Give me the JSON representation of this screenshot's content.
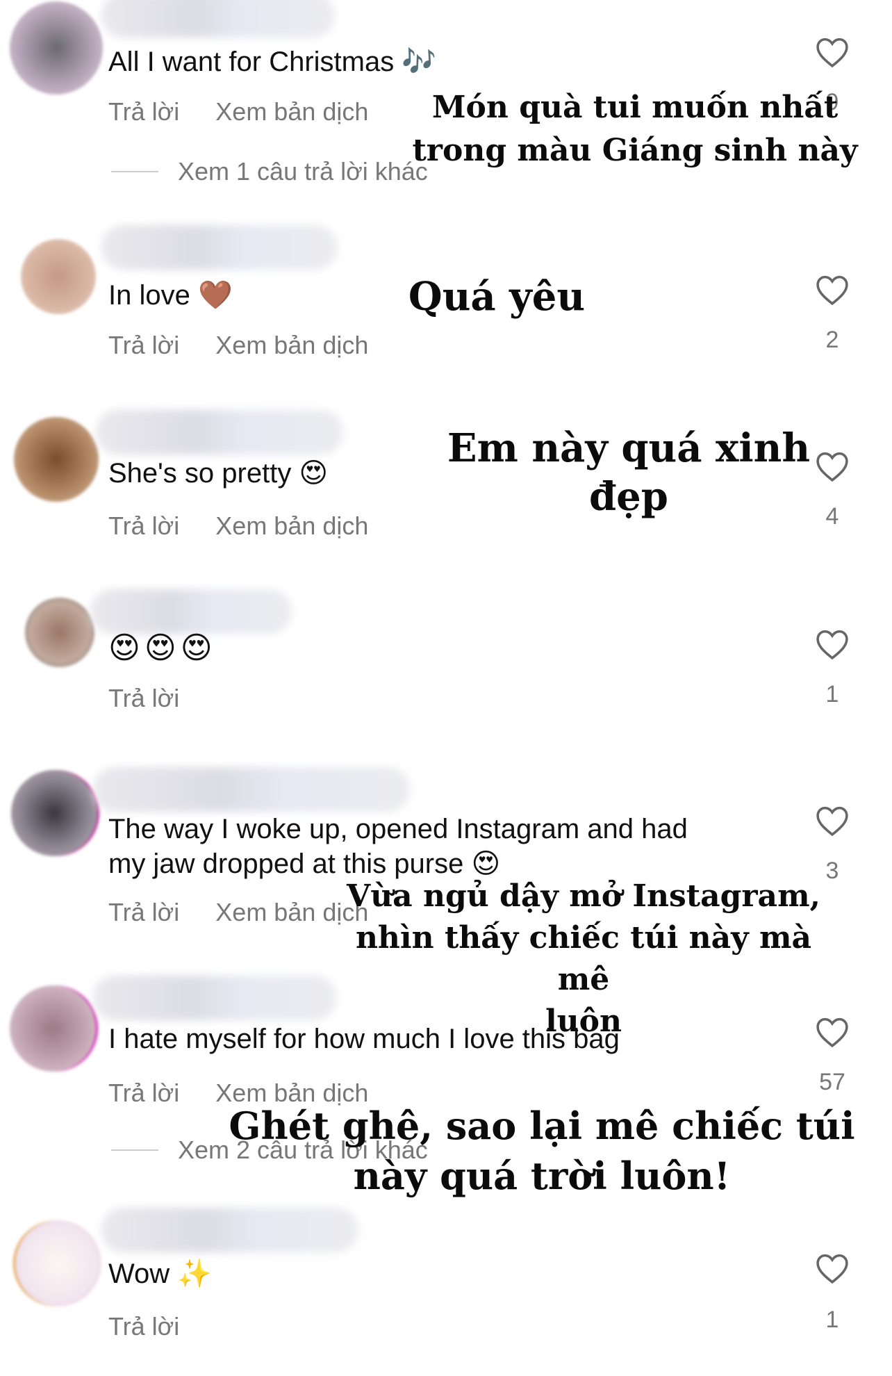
{
  "labels": {
    "reply": "Trả lời",
    "translate": "Xem bản dịch"
  },
  "comments": [
    {
      "text": "All I want for Christmas 🎶",
      "likes": "9",
      "has_translate": true,
      "more_replies": "Xem 1 câu trả lời khác",
      "overlay": "Món quà tui muốn nhất\ntrong màu Giáng sinh này"
    },
    {
      "text": "In love 🤎",
      "likes": "2",
      "has_translate": true,
      "overlay": "Quá yêu"
    },
    {
      "text": "She's so pretty 😍",
      "likes": "4",
      "has_translate": true,
      "overlay": "Em này quá xinh đẹp"
    },
    {
      "text": "😍😍😍",
      "likes": "1",
      "has_translate": false
    },
    {
      "text": "The way I woke up, opened Instagram and had\nmy jaw dropped at this purse 😍",
      "likes": "3",
      "has_translate": true,
      "overlay": "Vừa ngủ dậy mở Instagram,\nnhìn thấy chiếc túi này mà mê\nluôn"
    },
    {
      "text": "I hate myself for how much I love this bag",
      "likes": "57",
      "has_translate": true,
      "more_replies": "Xem 2 câu trả lời khác",
      "overlay": "Ghét ghê, sao lại mê chiếc túi\nnày quá trời luôn!"
    },
    {
      "text": "Wow ✨",
      "likes": "1",
      "has_translate": false
    }
  ],
  "colors": {
    "text": "#111111",
    "muted": "#777777",
    "background": "#ffffff"
  }
}
